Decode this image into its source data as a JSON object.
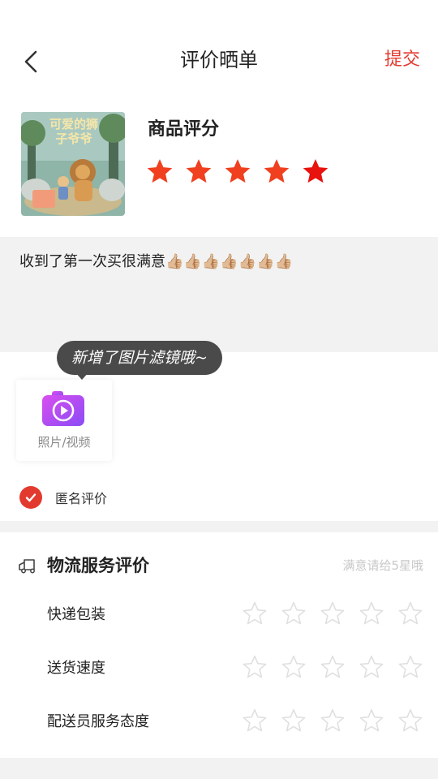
{
  "header": {
    "title": "评价晒单",
    "submit_label": "提交"
  },
  "product": {
    "book_title": "可爱的狮子爷爷",
    "rating_label": "商品评分",
    "rating": 5,
    "star_color": "#f0401f"
  },
  "comment": {
    "text": "收到了第一次买很满意👍🏼👍🏼👍🏼👍🏼👍🏼👍🏼👍🏼"
  },
  "tooltip": {
    "text": "新增了图片滤镜哦~"
  },
  "media": {
    "label": "照片/视频"
  },
  "anonymous": {
    "label": "匿名评价",
    "checked": true
  },
  "logistics": {
    "title": "物流服务评价",
    "hint": "满意请给5星哦",
    "items": [
      {
        "label": "快递包装",
        "rating": 0
      },
      {
        "label": "送货速度",
        "rating": 0
      },
      {
        "label": "配送员服务态度",
        "rating": 0
      }
    ]
  },
  "colors": {
    "accent": "#e33a2f",
    "panel": "#f2f2f2",
    "empty_star": "#e0e0e0"
  }
}
